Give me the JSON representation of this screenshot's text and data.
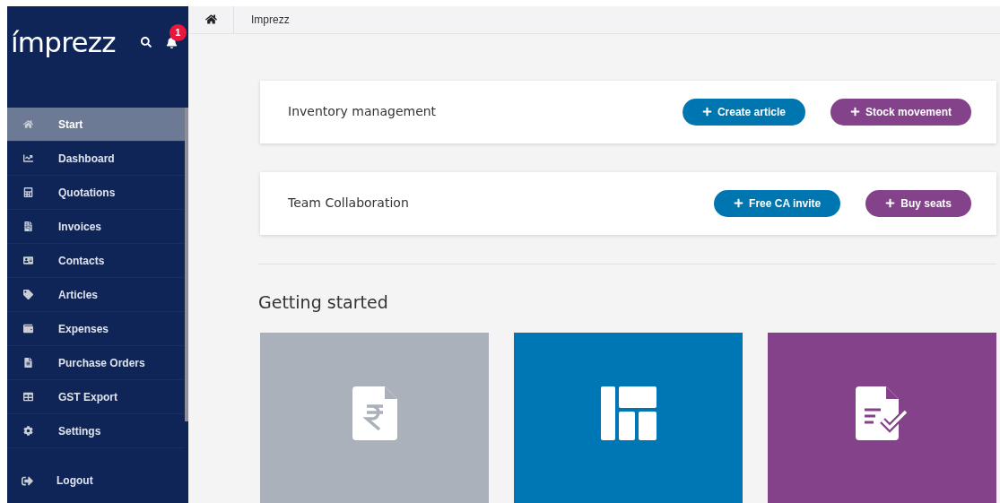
{
  "sidebar": {
    "logo": "ímprezz",
    "notification_count": "1",
    "items": [
      {
        "label": "Start",
        "selected": true
      },
      {
        "label": "Dashboard",
        "selected": false
      },
      {
        "label": "Quotations",
        "selected": false
      },
      {
        "label": "Invoices",
        "selected": false
      },
      {
        "label": "Contacts",
        "selected": false
      },
      {
        "label": "Articles",
        "selected": false
      },
      {
        "label": "Expenses",
        "selected": false
      },
      {
        "label": "Purchase Orders",
        "selected": false
      },
      {
        "label": "GST Export",
        "selected": false
      },
      {
        "label": "Settings",
        "selected": false
      }
    ],
    "logout": "Logout"
  },
  "breadcrumb": {
    "label": "Imprezz"
  },
  "panels": [
    {
      "title": "Inventory management",
      "buttons": [
        {
          "label": "Create article",
          "kind": "primary"
        },
        {
          "label": "Stock movement",
          "kind": "secondary"
        }
      ]
    },
    {
      "title": "Team Collaboration",
      "buttons": [
        {
          "label": "Free CA invite",
          "kind": "primary"
        },
        {
          "label": "Buy seats",
          "kind": "secondary"
        }
      ]
    }
  ],
  "getting_started": {
    "title": "Getting started",
    "tiles": [
      {
        "color": "#aab1ba"
      },
      {
        "color": "#0077b5"
      },
      {
        "color": "#84428a"
      }
    ]
  }
}
